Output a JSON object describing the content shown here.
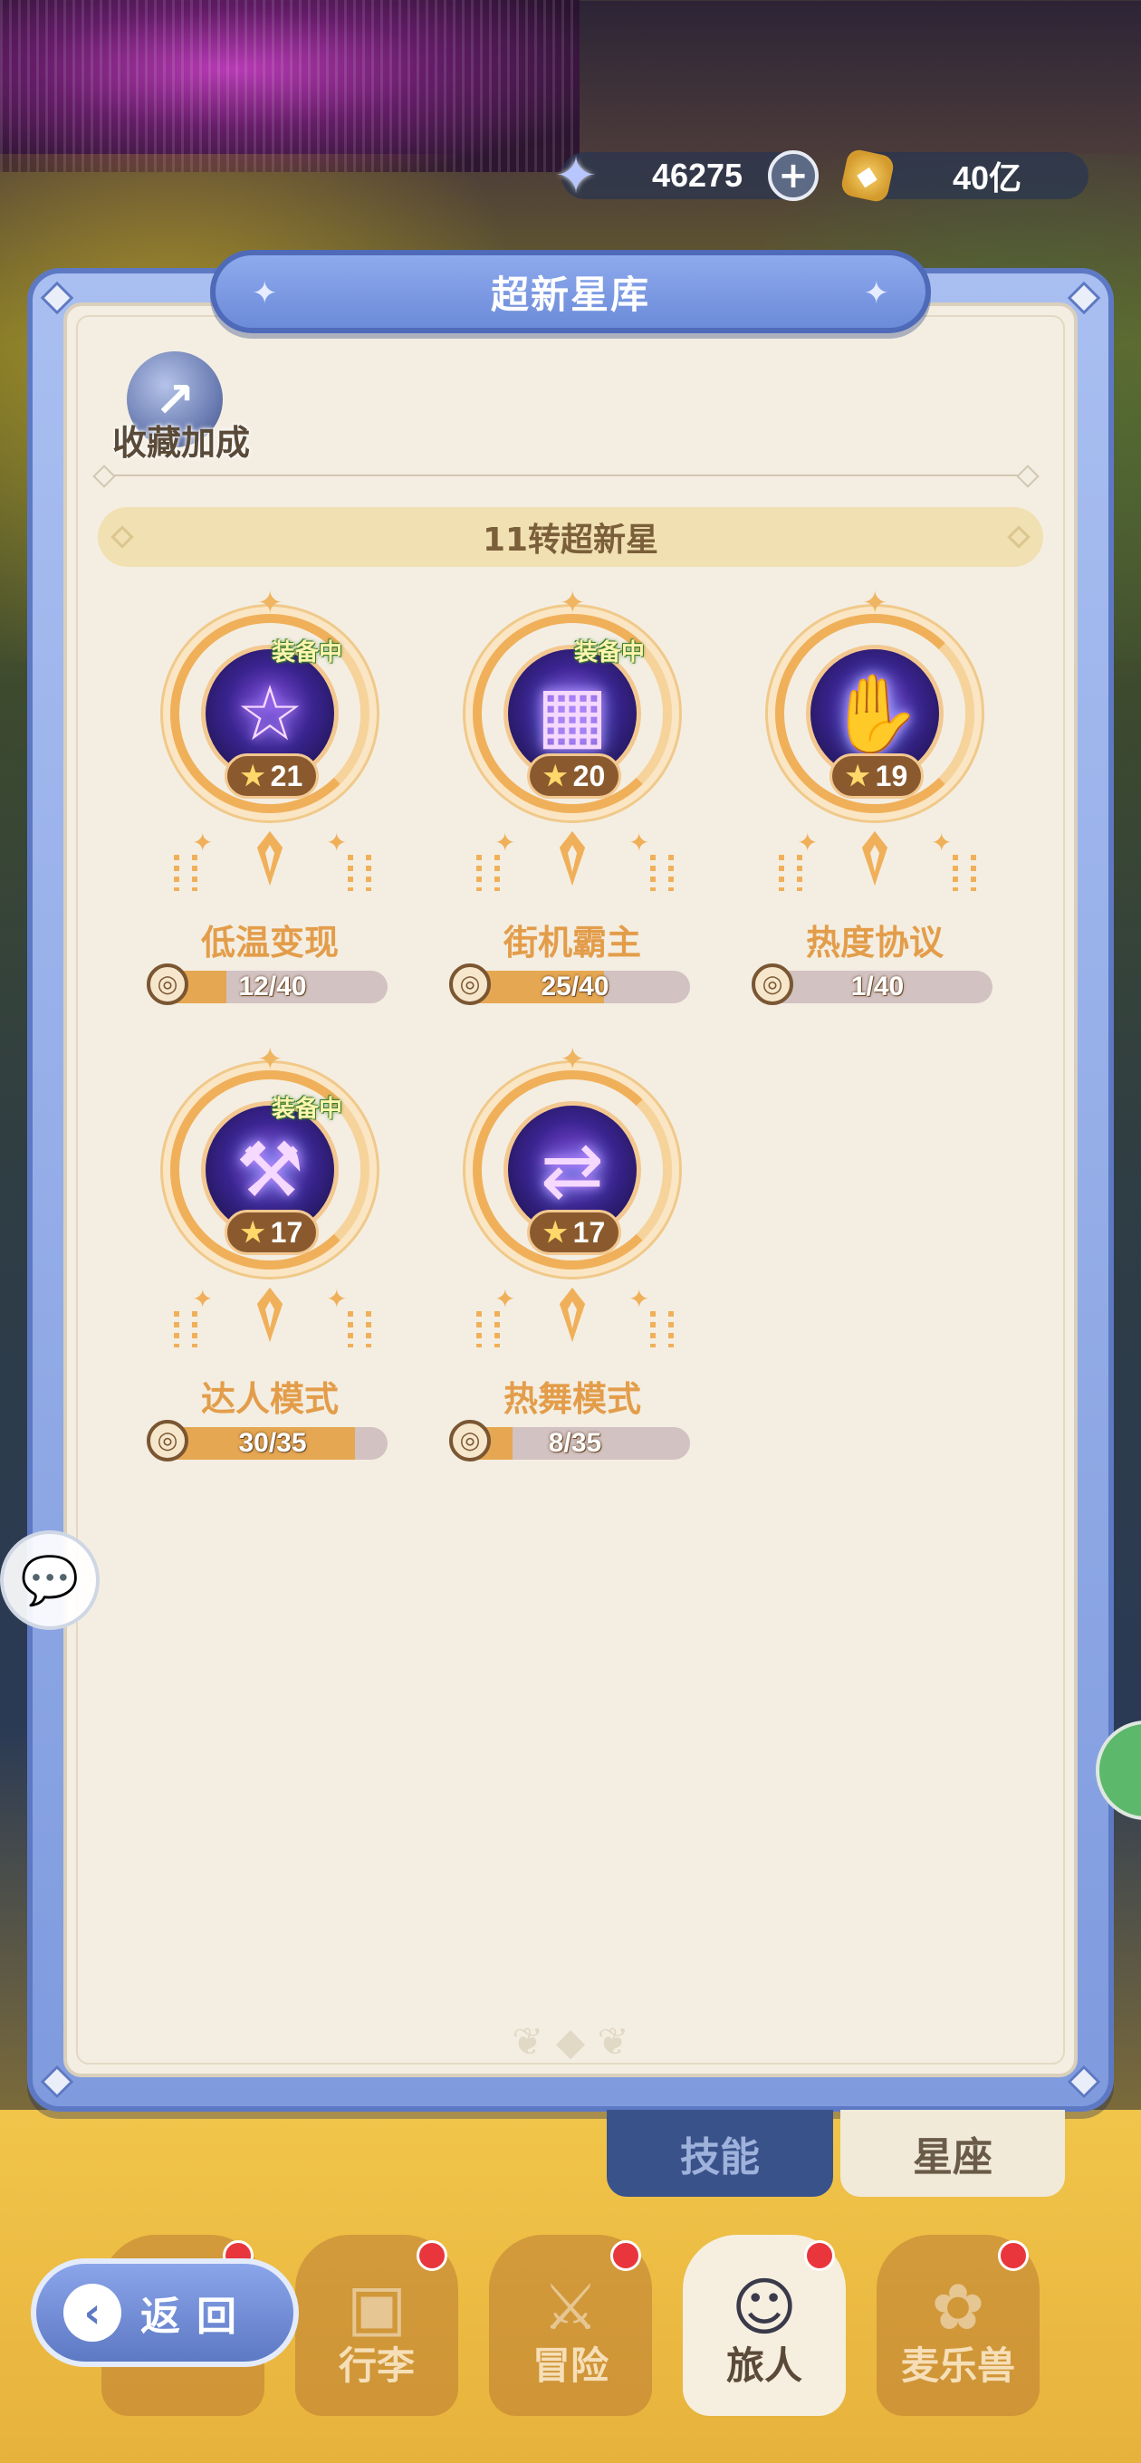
{
  "currency": {
    "stars": {
      "icon": "star-crystal-icon",
      "value": "46275",
      "add_label": "+"
    },
    "gold": {
      "icon": "gold-coin-icon",
      "value": "40亿"
    }
  },
  "panel": {
    "title": "超新星库",
    "bonus_label": "收藏加成",
    "section_title": "11转超新星"
  },
  "items": [
    {
      "name": "低温变现",
      "level": "21",
      "equipped": true,
      "equipped_label": "装备中",
      "progress_text": "12/40",
      "progress": 0.3,
      "icon": "star-icon",
      "glyph": "☆"
    },
    {
      "name": "街机霸主",
      "level": "20",
      "equipped": true,
      "equipped_label": "装备中",
      "progress_text": "25/40",
      "progress": 0.625,
      "icon": "arcade-box-icon",
      "glyph": "▦"
    },
    {
      "name": "热度协议",
      "level": "19",
      "equipped": false,
      "equipped_label": "",
      "progress_text": "1/40",
      "progress": 0.025,
      "icon": "hand-bottle-icon",
      "glyph": "✋"
    },
    {
      "name": "达人模式",
      "level": "17",
      "equipped": true,
      "equipped_label": "装备中",
      "progress_text": "30/35",
      "progress": 0.857,
      "icon": "tools-icon",
      "glyph": "⚒"
    },
    {
      "name": "热舞模式",
      "level": "17",
      "equipped": false,
      "equipped_label": "",
      "progress_text": "8/35",
      "progress": 0.229,
      "icon": "arrows-icon",
      "glyph": "⇄"
    }
  ],
  "tabs": {
    "skill": "技能",
    "constellation": "星座"
  },
  "nav": {
    "back": "返回",
    "buttons": [
      {
        "label": "",
        "icon": "home-icon"
      },
      {
        "label": "行李",
        "icon": "luggage-icon"
      },
      {
        "label": "冒险",
        "icon": "crossed-swords-icon"
      },
      {
        "label": "旅人",
        "icon": "traveler-icon"
      },
      {
        "label": "麦乐兽",
        "icon": "pet-icon"
      }
    ]
  }
}
